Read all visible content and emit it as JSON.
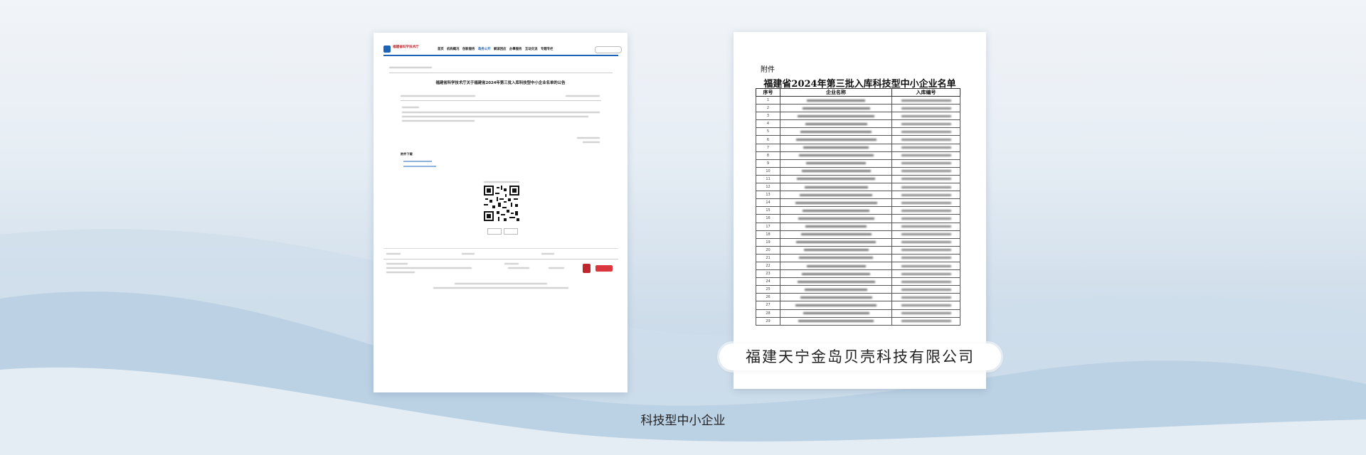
{
  "colors": {
    "accent_blue": "#1d63b8",
    "emblem_red": "#c0272d"
  },
  "left_doc": {
    "site_name": "福建省科学技术厅",
    "nav": [
      "首页",
      "机构概况",
      "创新服务",
      "政务公开",
      "解读回应",
      "办事服务",
      "互动交流",
      "专题专栏"
    ],
    "active_nav": "政务公开",
    "title": "福建省科学技术厅关于福建省2024年第三批入库科技型中小企业名单的公告",
    "attachments_heading": "附件下载"
  },
  "right_doc": {
    "annex_label": "附件",
    "title": "福建省2024年第三批入库科技型中小企业名单",
    "columns": [
      "序号",
      "企业名称",
      "入库编号"
    ],
    "rows": [
      {
        "no": "1"
      },
      {
        "no": "2"
      },
      {
        "no": "3"
      },
      {
        "no": "4"
      },
      {
        "no": "5"
      },
      {
        "no": "6"
      },
      {
        "no": "7"
      },
      {
        "no": "8"
      },
      {
        "no": "9"
      },
      {
        "no": "10"
      },
      {
        "no": "11"
      },
      {
        "no": "12"
      },
      {
        "no": "13"
      },
      {
        "no": "14"
      },
      {
        "no": "15"
      },
      {
        "no": "16"
      },
      {
        "no": "17"
      },
      {
        "no": "18"
      },
      {
        "no": "19"
      },
      {
        "no": "20"
      },
      {
        "no": "21"
      },
      {
        "no": "22"
      },
      {
        "no": "23"
      },
      {
        "no": "24"
      },
      {
        "no": "25"
      },
      {
        "no": "26"
      },
      {
        "no": "27"
      },
      {
        "no": "28"
      },
      {
        "no": "29"
      }
    ]
  },
  "highlight_company": "福建天宁金岛贝壳科技有限公司",
  "caption": "科技型中小企业"
}
